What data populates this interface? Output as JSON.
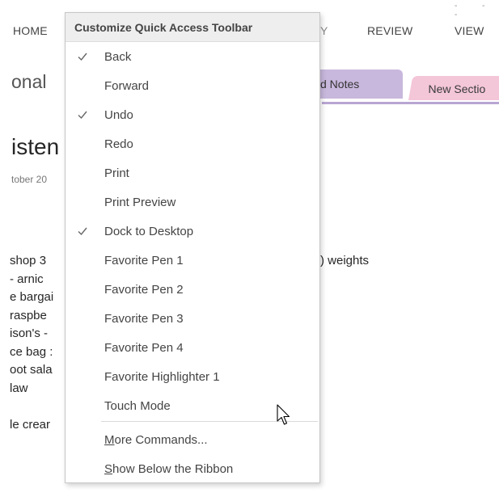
{
  "ribbon": {
    "tabs": [
      "HOME",
      "REVIEW",
      "VIEW"
    ],
    "partial_tab": "Y"
  },
  "notebook": {
    "name_partial": "onal",
    "section_tabs": [
      {
        "label": "Detailed Notes",
        "visible_label": "iled Notes",
        "color": "#c9b8dd",
        "active": true
      },
      {
        "label": "New Section",
        "visible_label": "New Sectio",
        "color": "#f3c6d8",
        "active": false
      }
    ]
  },
  "page": {
    "title_partial": "isten",
    "date_partial": "tober 20",
    "lines_partial": [
      "shop 3",
      "- arnic",
      "e bargai",
      "raspbe",
      "ison's -",
      "ce bag :",
      "oot sala",
      "law",
      "",
      "le crear"
    ],
    "right_text_partial": ") weights"
  },
  "qat_menu": {
    "title": "Customize Quick Access Toolbar",
    "items": [
      {
        "label": "Back",
        "checked": true
      },
      {
        "label": "Forward",
        "checked": false
      },
      {
        "label": "Undo",
        "checked": true
      },
      {
        "label": "Redo",
        "checked": false
      },
      {
        "label": "Print",
        "checked": false
      },
      {
        "label": "Print Preview",
        "checked": false
      },
      {
        "label": "Dock to Desktop",
        "checked": true
      },
      {
        "label": "Favorite Pen 1",
        "checked": false
      },
      {
        "label": "Favorite Pen 2",
        "checked": false
      },
      {
        "label": "Favorite Pen 3",
        "checked": false
      },
      {
        "label": "Favorite Pen 4",
        "checked": false
      },
      {
        "label": "Favorite Highlighter 1",
        "checked": false
      },
      {
        "label": "Touch Mode",
        "checked": false
      }
    ],
    "more_commands": {
      "accel": "M",
      "rest": "ore Commands..."
    },
    "show_below": {
      "accel": "S",
      "rest": "how Below the Ribbon"
    }
  },
  "colors": {
    "menu_header_bg": "#eeeeee",
    "menu_border": "#c6c6c6",
    "check_color": "#666666"
  }
}
